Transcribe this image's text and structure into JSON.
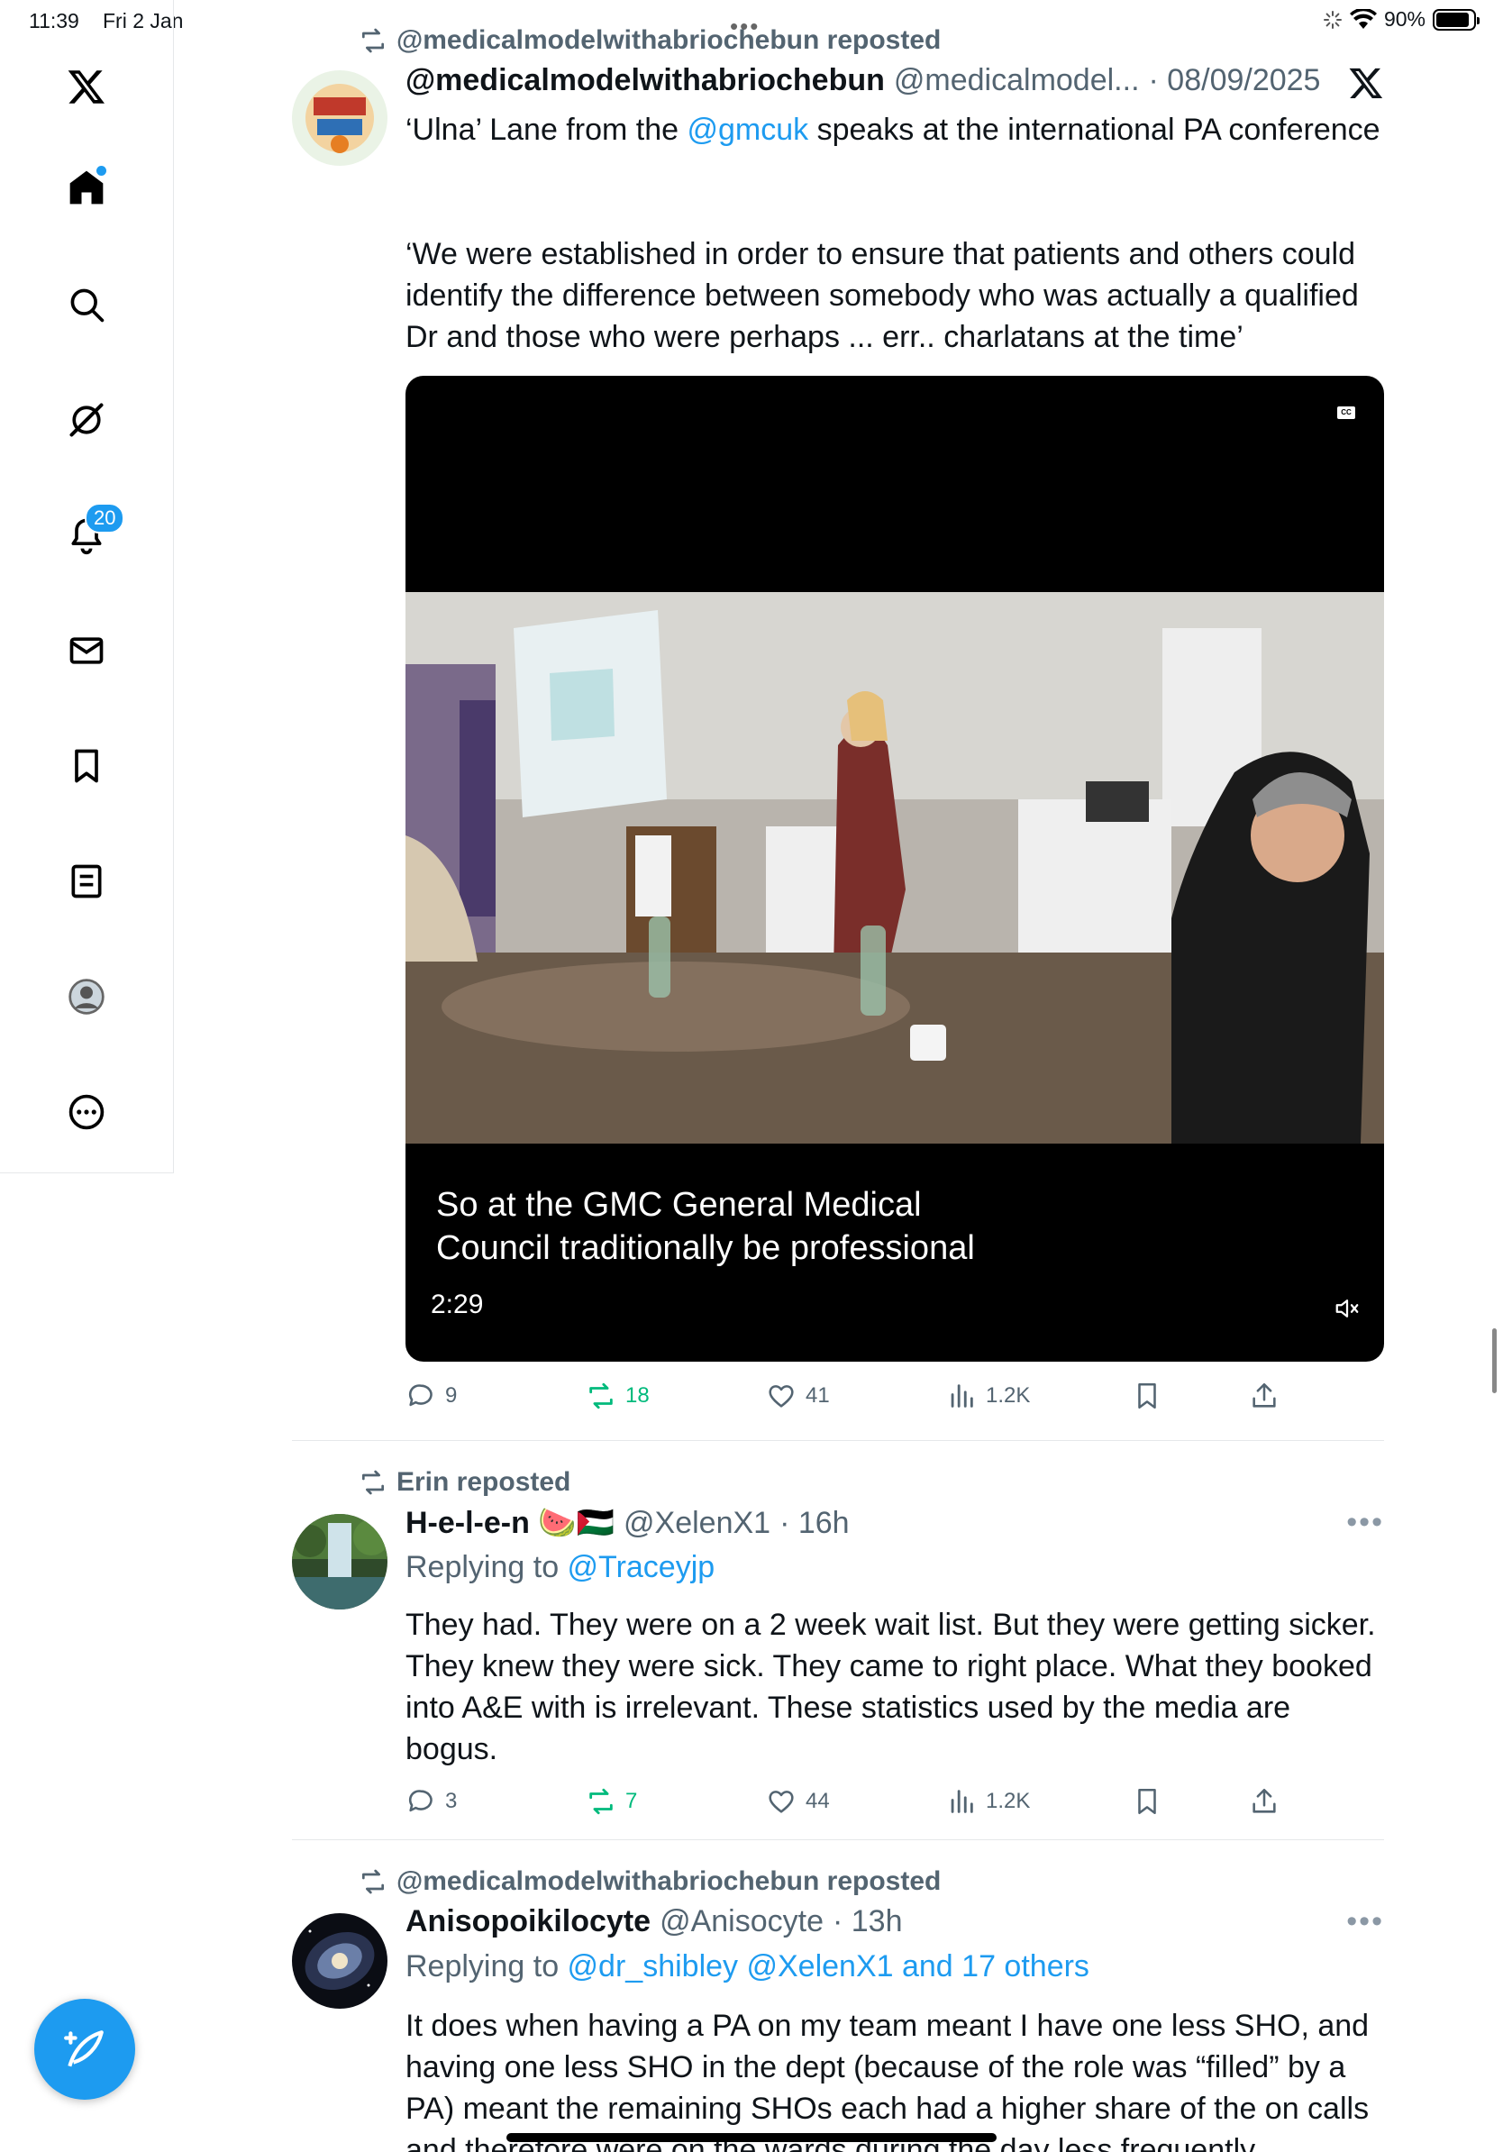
{
  "status_bar": {
    "time": "11:39",
    "date": "Fri 2 Jan",
    "battery": "90%",
    "icons": [
      "loading-icon",
      "wifi-icon",
      "battery-icon"
    ]
  },
  "sidebar": {
    "items": [
      {
        "name": "x-logo",
        "icon": "x-logo-icon"
      },
      {
        "name": "home",
        "icon": "home-icon",
        "badge_dot": true
      },
      {
        "name": "search",
        "icon": "search-icon"
      },
      {
        "name": "grok",
        "icon": "grok-icon"
      },
      {
        "name": "notifications",
        "icon": "bell-icon",
        "badge": "20"
      },
      {
        "name": "messages",
        "icon": "mail-icon"
      },
      {
        "name": "bookmarks",
        "icon": "bookmark-icon"
      },
      {
        "name": "lists",
        "icon": "list-icon"
      },
      {
        "name": "profile",
        "icon": "profile-icon"
      },
      {
        "name": "more",
        "icon": "more-circle-icon"
      }
    ],
    "compose_icon": "compose-feather-icon"
  },
  "colors": {
    "accent": "#1d9bf0",
    "repost_green": "#00ba7c",
    "muted": "#536471",
    "text": "#0f1419"
  },
  "posts": [
    {
      "repost_label": "@medicalmodelwithabriochebun reposted",
      "display_name": "@medicalmodelwithabriochebun",
      "handle": "@medicalmodel...",
      "time": "· 08/09/2025",
      "text_line1_pre": "‘Ulna’ Lane from the ",
      "text_line1_link": "@gmcuk",
      "text_line1_post": " speaks at the international PA conference",
      "text_para2": "‘We were established in order to ensure that patients and others could identify the difference between somebody who was actually a qualified Dr and those who were perhaps ... err.. charlatans at the time’",
      "video": {
        "caption_line1": "So at the GMC General Medical",
        "caption_line2": "Council traditionally be professional",
        "duration": "2:29",
        "cc": "CC"
      },
      "stats": {
        "replies": "9",
        "reposts": "18",
        "likes": "41",
        "views": "1.2K"
      }
    },
    {
      "repost_label": "Erin reposted",
      "display_name": "H-e-l-e-n 🍉🇵🇸",
      "handle": "@XelenX1",
      "time": "· 16h",
      "replying_label": "Replying to ",
      "replying_to": "@Traceyjp",
      "text": "They had. They were on a 2 week wait list. But they were getting sicker. They knew they were sick. They came to right place. What they booked into A&E with is irrelevant. These statistics used by the media are bogus.",
      "stats": {
        "replies": "3",
        "reposts": "7",
        "likes": "44",
        "views": "1.2K"
      }
    },
    {
      "repost_label": "@medicalmodelwithabriochebun reposted",
      "display_name": "Anisopoikilocyte",
      "handle": "@Anisocyte",
      "time": "· 13h",
      "replying_label": "Replying to ",
      "replying_to": "@dr_shibley @XelenX1 and 17 others",
      "text": "It does when having a PA on my team meant I have one less SHO, and having one less SHO in the dept (because of the role was “filled” by a PA) meant the remaining SHOs each had a higher share of the on calls and therefore were on the wards during the day less frequently."
    }
  ]
}
